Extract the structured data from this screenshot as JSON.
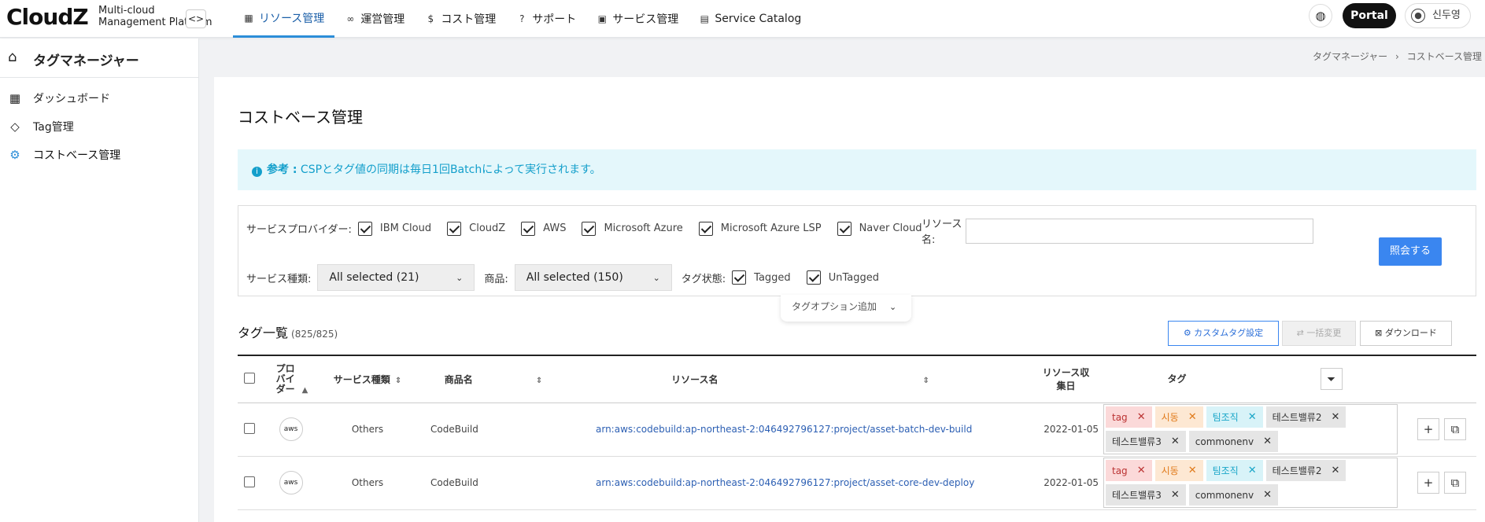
{
  "header": {
    "logo": "CloudZ",
    "logo_sub_1": "Multi-cloud",
    "logo_sub_2": "Management Platform",
    "nav": [
      {
        "icon": "grid-icon",
        "label": "リソース管理",
        "active": true
      },
      {
        "icon": "link-icon",
        "label": "運営管理"
      },
      {
        "icon": "dollar-icon",
        "label": "コスト管理"
      },
      {
        "icon": "help-icon",
        "label": "サポート"
      },
      {
        "icon": "grid-add-icon",
        "label": "サービス管理"
      },
      {
        "icon": "catalog-icon",
        "label": "Service Catalog"
      }
    ],
    "portal_label": "Portal",
    "user_name": "신두영"
  },
  "sidebar": {
    "title": "タグマネージャー",
    "items": [
      {
        "icon": "dashboard-icon",
        "label": "ダッシュボード"
      },
      {
        "icon": "tags-icon",
        "label": "Tag管理"
      },
      {
        "icon": "cost-gear-icon",
        "label": "コストベース管理",
        "active": true
      }
    ]
  },
  "breadcrumb": {
    "parent": "タグマネージャー",
    "sep": "›",
    "current": "コストベース管理"
  },
  "main": {
    "title": "コストベース管理",
    "notice_bold": "参考 :",
    "notice_text": " CSPとタグ値の同期は毎日1回Batchによって実行されます。",
    "filter": {
      "provider_label": "サービスプロバイダー:",
      "providers": [
        "IBM Cloud",
        "CloudZ",
        "AWS",
        "Microsoft Azure",
        "Microsoft Azure LSP",
        "Naver Cloud"
      ],
      "resource_name_label_1": "リソース",
      "resource_name_label_2": "名:",
      "resource_name_value": "",
      "service_type_label": "サービス種類:",
      "service_type_value": "All selected (21)",
      "product_label": "商品:",
      "product_value": "All selected (150)",
      "tag_status_label": "タグ状態:",
      "tag_statuses": [
        "Tagged",
        "UnTagged"
      ],
      "search_button": "照会する",
      "tag_option_label": "タグオプション追加"
    },
    "list": {
      "title": "タグ一覧",
      "count": "(825/825)",
      "custom_tag_button": "カスタムタグ設定",
      "bulk_change_button": "一括変更",
      "download_button": "ダウンロード",
      "columns": {
        "provider": "プロバイダー",
        "service_type": "サービス種類",
        "product": "商品名",
        "resource": "リソース名",
        "collected_1": "リソース収",
        "collected_2": "集日",
        "tag": "タグ"
      },
      "rows": [
        {
          "provider": "aws",
          "service_type": "Others",
          "product": "CodeBuild",
          "resource": "arn:aws:codebuild:ap-northeast-2:046492796127:project/asset-batch-dev-build",
          "date": "2022-01-05",
          "tags": [
            "tag",
            "시동",
            "팀조직",
            "테스트밸류2",
            "테스트밸류3",
            "commonenv"
          ]
        },
        {
          "provider": "aws",
          "service_type": "Others",
          "product": "CodeBuild",
          "resource": "arn:aws:codebuild:ap-northeast-2:046492796127:project/asset-core-dev-deploy",
          "date": "2022-01-05",
          "tags": [
            "tag",
            "시동",
            "팀조직",
            "테스트밸류2",
            "테스트밸류3",
            "commonenv"
          ]
        }
      ]
    }
  },
  "colors": {
    "accent": "#2c8ed8",
    "button": "#3a86f0",
    "notice_bg": "#e4f7fb"
  }
}
